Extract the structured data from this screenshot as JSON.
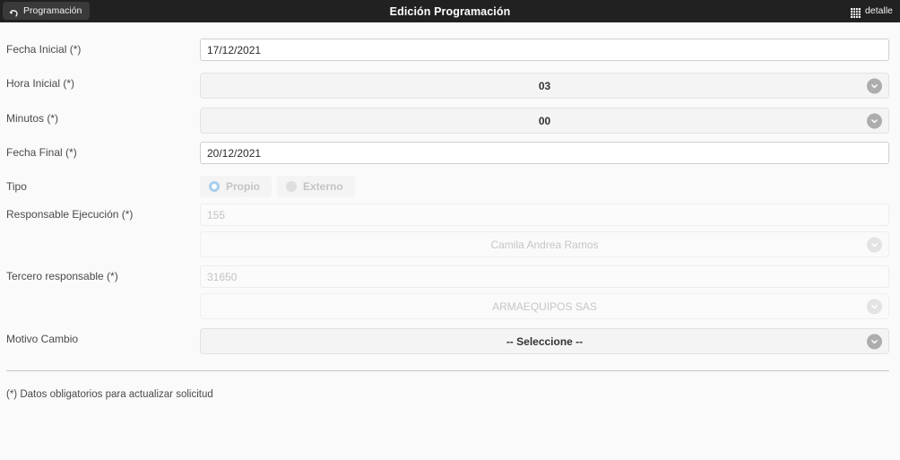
{
  "topbar": {
    "back_label": "Programación",
    "back_icon": "back-arrow-icon",
    "title": "Edición Programación",
    "detail_label": "detalle",
    "detail_icon": "grid-icon",
    "background": "#212121",
    "title_color": "#ffffff"
  },
  "form": {
    "fields": {
      "fecha_inicial": {
        "label": "Fecha Inicial (*)",
        "value": "17/12/2021"
      },
      "hora_inicial": {
        "label": "Hora Inicial (*)",
        "value": "03"
      },
      "minutos": {
        "label": "Minutos (*)",
        "value": "00"
      },
      "fecha_final": {
        "label": "Fecha Final (*)",
        "value": "20/12/2021"
      },
      "tipo": {
        "label": "Tipo",
        "options": [
          {
            "label": "Propio",
            "selected": true
          },
          {
            "label": "Externo",
            "selected": false
          }
        ],
        "option_propio": "Propio",
        "option_externo": "Externo",
        "selected_color": "#a8cfee"
      },
      "responsable_ejecucion": {
        "label": "Responsable Ejecución (*)",
        "code": "155",
        "name": "Camila Andrea Ramos"
      },
      "tercero_responsable": {
        "label": "Tercero responsable (*)",
        "code": "31650",
        "name": "ARMAEQUIPOS SAS"
      },
      "motivo_cambio": {
        "label": "Motivo Cambio",
        "value": "-- Seleccione --"
      }
    }
  },
  "footer": {
    "note": "(*) Datos obligatorios para actualizar solicitud"
  }
}
